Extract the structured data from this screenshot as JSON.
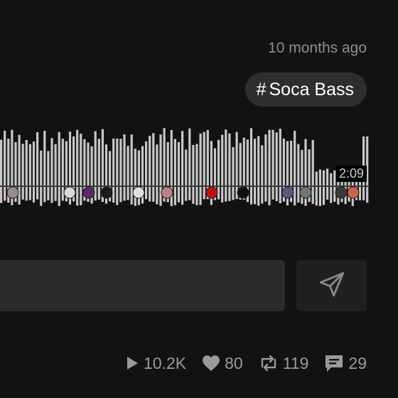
{
  "track": {
    "posted": "10 months ago",
    "tag": {
      "hash": "#",
      "label": "Soca Bass"
    },
    "duration": "2:09"
  },
  "comment": {
    "placeholder": "",
    "value": ""
  },
  "stats": {
    "plays": "10.2K",
    "likes": "80",
    "reposts": "119",
    "comments": "29"
  },
  "colors": {
    "background": "#121212",
    "waveform": "#c8c8c8",
    "tag_bg": "#2e2e2e",
    "input_bg": "#2b2b2b",
    "send_bg": "#202020",
    "stat_text": "#9a9a9a"
  },
  "icons": {
    "send": "paper-plane-icon",
    "plays": "play-icon",
    "likes": "heart-icon",
    "reposts": "repost-icon",
    "comments": "comment-icon"
  }
}
